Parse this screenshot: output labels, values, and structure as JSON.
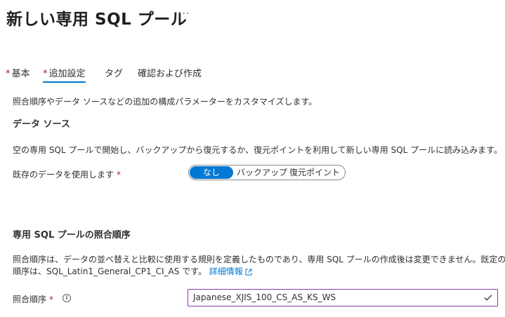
{
  "header": {
    "title": "新しい専用 SQL プール",
    "more": "···"
  },
  "tabs": [
    {
      "label": "基本",
      "required": "*"
    },
    {
      "label": "追加設定",
      "required": "*"
    },
    {
      "label": "タグ",
      "required": ""
    },
    {
      "label": "確認および作成",
      "required": ""
    }
  ],
  "intro": "照合順序やデータ ソースなどの追加の構成パラメーターをカスタマイズします。",
  "datasource": {
    "heading": "データ ソース",
    "description": "空の専用 SQL プールで開始し、バックアップから復元するか、復元ポイントを利用して新しい専用 SQL プールに読み込みます。",
    "field_label": "既存のデータを使用します",
    "required": "*",
    "options": [
      "なし",
      "バックアップ",
      "復元ポイント"
    ],
    "selected": "なし"
  },
  "collation": {
    "heading": "専用 SQL プールの照合順序",
    "description_line1": "照合順序は、データの並べ替えと比較に使用する規則を定義したものであり、専用 SQL プールの作成後は変更できません。既定の照合",
    "description_line2": "順序は、SQL_Latin1_General_CP1_CI_AS です。",
    "link": "詳細情報",
    "field_label": "照合順序",
    "required": "*",
    "info": "i",
    "value": "Japanese_XJIS_100_CS_AS_KS_WS"
  },
  "colors": {
    "accent": "#0078d4",
    "required": "#a4262c",
    "focus_border": "#8a3ca6"
  }
}
